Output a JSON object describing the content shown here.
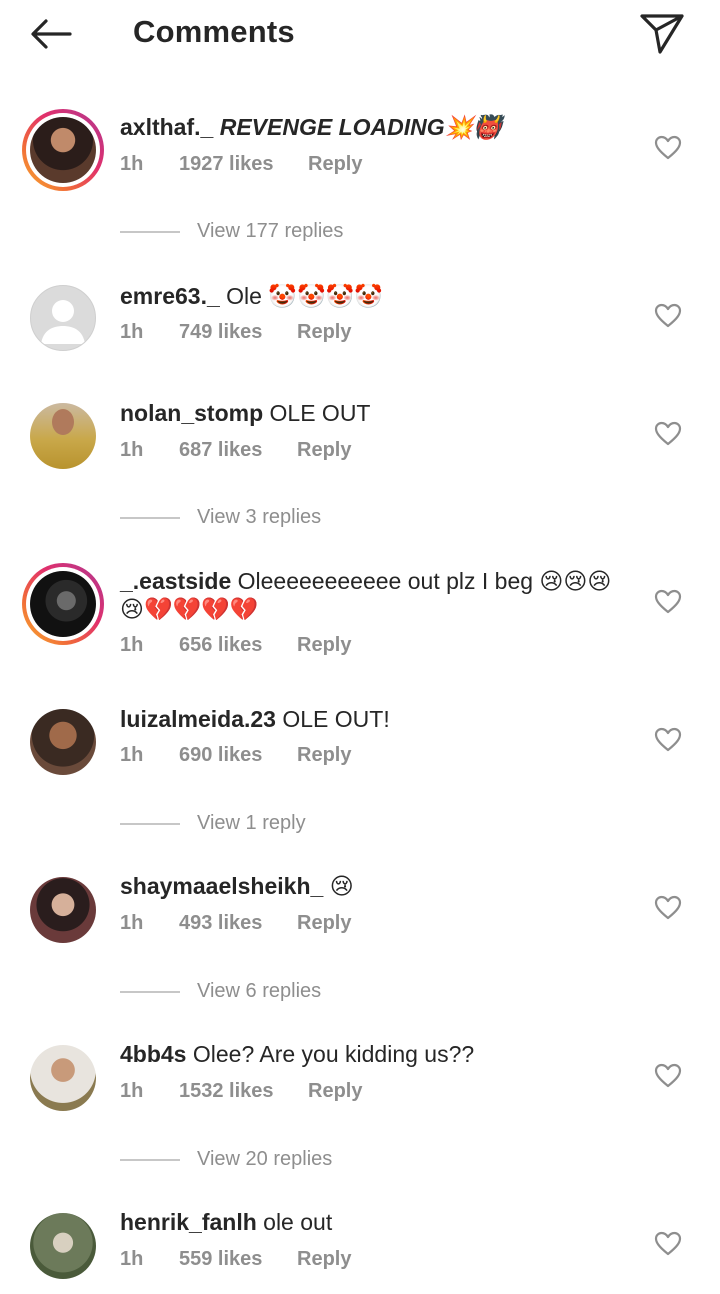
{
  "header": {
    "title": "Comments",
    "back_icon": "back-arrow-icon",
    "share_icon": "send-icon"
  },
  "comments": [
    {
      "username": "axlthaf._",
      "text": "REVENGE LOADING💥👹",
      "time": "1h",
      "likes": "1927 likes",
      "reply": "Reply",
      "view_replies": "View 177 replies",
      "avatar_ring": true,
      "avatar_color": "#6b3b2a"
    },
    {
      "username": "emre63._",
      "text": "Ole 🤡🤡🤡🤡",
      "time": "1h",
      "likes": "749 likes",
      "reply": "Reply",
      "avatar_ring": false,
      "avatar_color": "#d6d6d6"
    },
    {
      "username": "nolan_stomp",
      "text": "OLE OUT",
      "time": "1h",
      "likes": "687 likes",
      "reply": "Reply",
      "view_replies": "View 3 replies",
      "avatar_ring": false,
      "avatar_color": "#c9a84a"
    },
    {
      "username": "_.eastside",
      "text": "Oleeeeeeeeeee out plz I beg 😢😢😢",
      "text2": "😢💔💔💔💔",
      "time": "1h",
      "likes": "656 likes",
      "reply": "Reply",
      "avatar_ring": true,
      "avatar_color": "#1c1c1c"
    },
    {
      "username": "luizalmeida.23",
      "text": "OLE OUT!",
      "time": "1h",
      "likes": "690 likes",
      "reply": "Reply",
      "view_replies": "View 1 reply",
      "avatar_ring": false,
      "avatar_color": "#5a4032"
    },
    {
      "username": "shaymaaelsheikh_",
      "text": "😢",
      "time": "1h",
      "likes": "493 likes",
      "reply": "Reply",
      "view_replies": "View 6 replies",
      "avatar_ring": false,
      "avatar_color": "#3a2a2a"
    },
    {
      "username": "4bb4s",
      "text": "Olee? Are you kidding us??",
      "time": "1h",
      "likes": "1532 likes",
      "reply": "Reply",
      "view_replies": "View 20 replies",
      "avatar_ring": false,
      "avatar_color": "#8a7a50"
    },
    {
      "username": "henrik_fanlh",
      "text": "ole out",
      "time": "1h",
      "likes": "559 likes",
      "reply": "Reply",
      "avatar_ring": false,
      "avatar_color": "#6c7a5a"
    }
  ]
}
